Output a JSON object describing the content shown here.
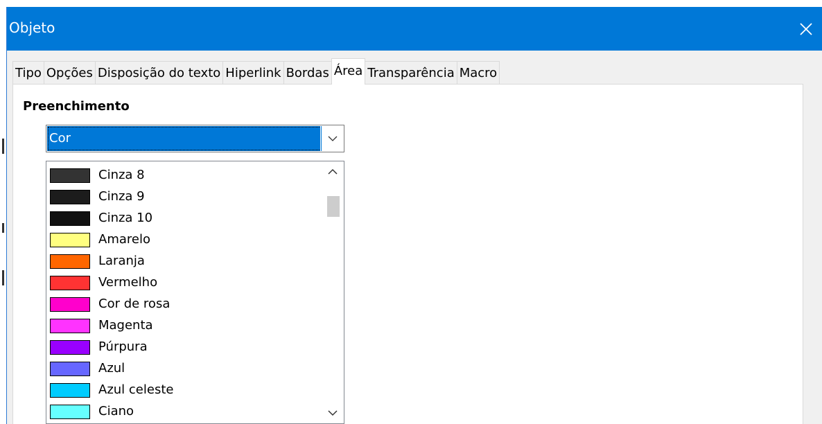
{
  "dialog": {
    "title": "Objeto",
    "close_icon": "close-icon"
  },
  "tabs": [
    {
      "label": "Tipo",
      "active": false
    },
    {
      "label": "Opções",
      "active": false
    },
    {
      "label": "Disposição do texto",
      "active": false
    },
    {
      "label": "Hiperlink",
      "active": false
    },
    {
      "label": "Bordas",
      "active": false
    },
    {
      "label": "Área",
      "active": true
    },
    {
      "label": "Transparência",
      "active": false
    },
    {
      "label": "Macro",
      "active": false
    }
  ],
  "area": {
    "section_label": "Preenchimento",
    "fill_type": {
      "selected": "Cor",
      "icon": "chevron-down-icon"
    },
    "colors": [
      {
        "name": "Cinza 8",
        "hex": "#333333"
      },
      {
        "name": "Cinza 9",
        "hex": "#1c1c1c"
      },
      {
        "name": "Cinza 10",
        "hex": "#111111"
      },
      {
        "name": "Amarelo",
        "hex": "#ffff80"
      },
      {
        "name": "Laranja",
        "hex": "#ff6600"
      },
      {
        "name": "Vermelho",
        "hex": "#ff3333"
      },
      {
        "name": "Cor de rosa",
        "hex": "#ff00cc"
      },
      {
        "name": "Magenta",
        "hex": "#ff33ff"
      },
      {
        "name": "Púrpura",
        "hex": "#9900ff"
      },
      {
        "name": "Azul",
        "hex": "#6666ff"
      },
      {
        "name": "Azul celeste",
        "hex": "#00ccff"
      },
      {
        "name": "Ciano",
        "hex": "#66ffff"
      },
      {
        "name": "",
        "hex": "#888888"
      }
    ],
    "scrollbar": {
      "up_icon": "chevron-up-icon",
      "down_icon": "chevron-down-icon"
    }
  },
  "colors": {
    "titlebar": "#0078d7",
    "selection": "#0078d7"
  }
}
